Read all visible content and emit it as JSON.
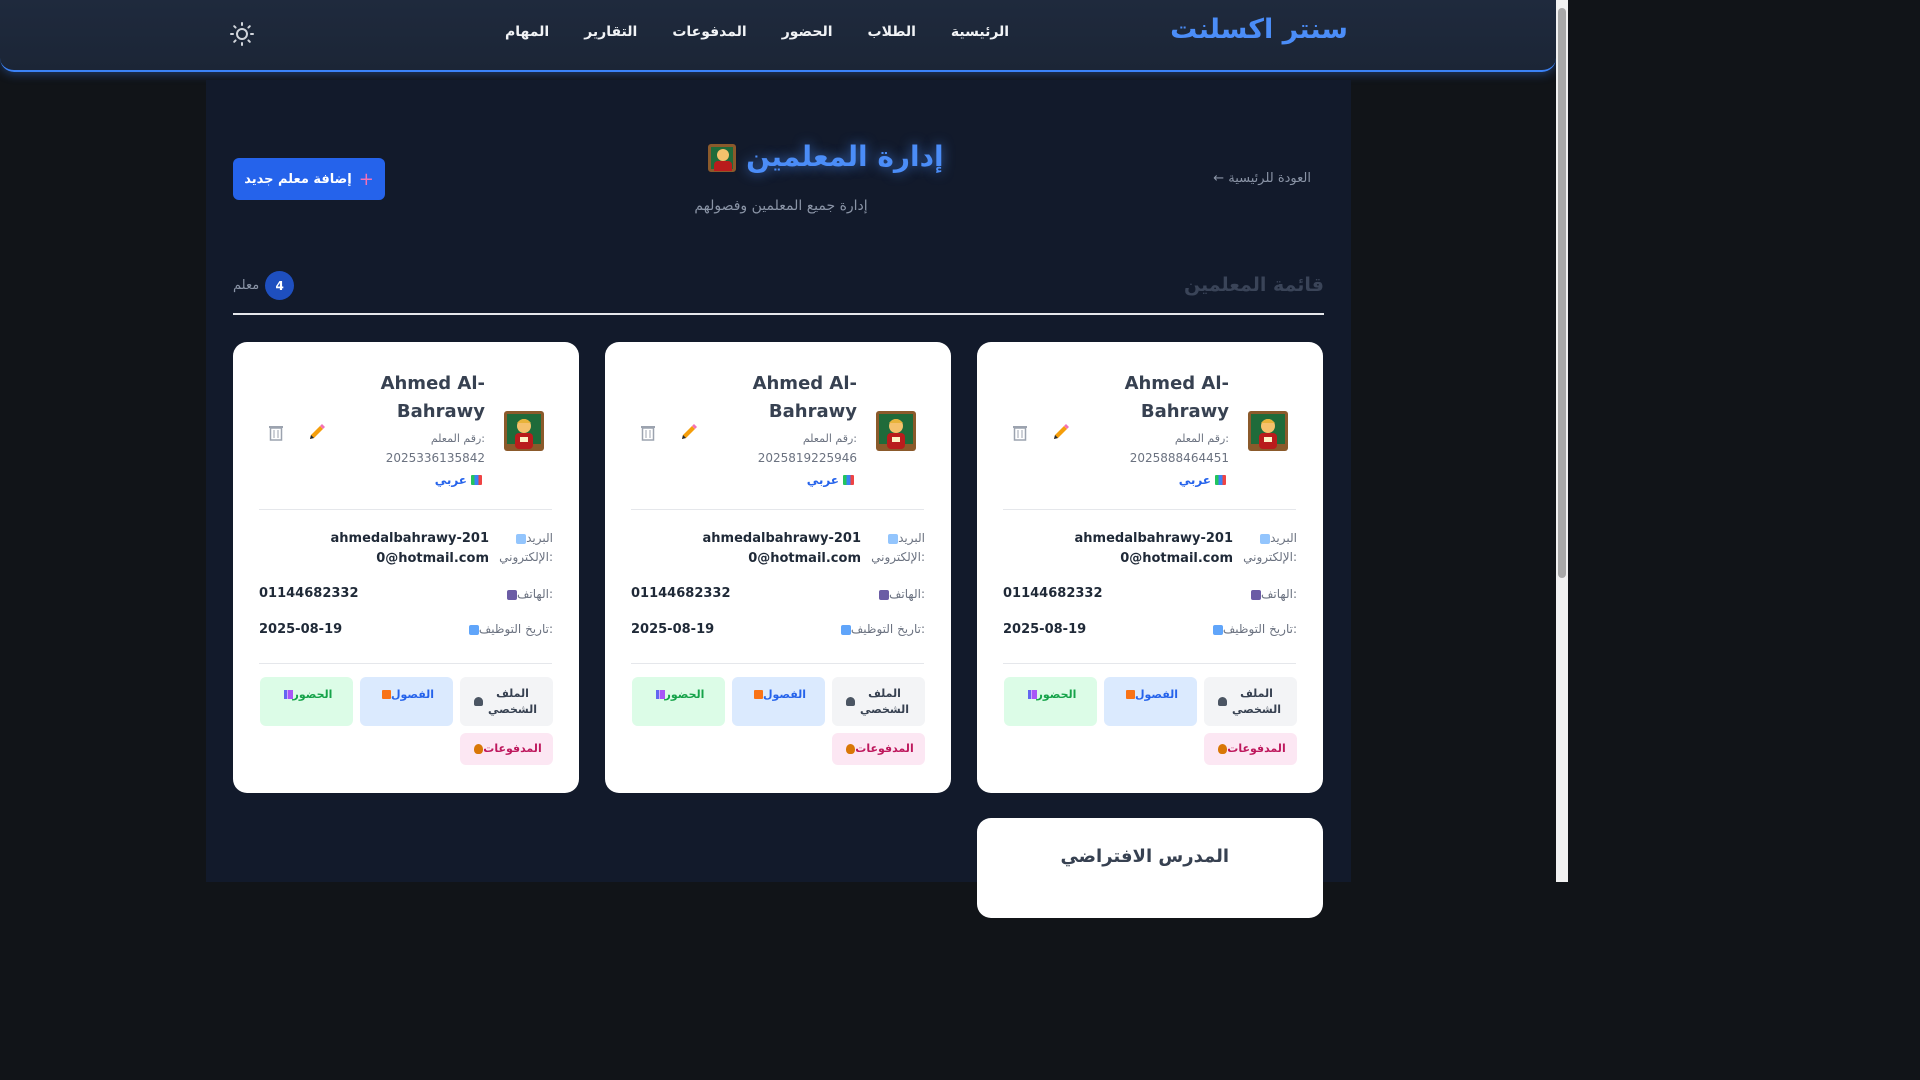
{
  "navbar": {
    "brand": "سنتر اكسلنت",
    "links": [
      "الرئيسية",
      "الطلاب",
      "الحضور",
      "المدفوعات",
      "التقارير",
      "المهام"
    ],
    "theme_icon": "sun-icon"
  },
  "page": {
    "title": "إدارة المعلمين",
    "title_icon": "teacher-icon",
    "subtitle": "إدارة جميع المعلمين وفصولهم",
    "back_link": "← العودة للرئيسية",
    "add_button": "إضافة معلم جديد",
    "add_icon": "plus-icon"
  },
  "list": {
    "title": "قائمة المعلمين",
    "count": "4",
    "count_label": "معلم"
  },
  "labels": {
    "teacher_number": "رقم المعلم:",
    "email": "البريد الإلكتروني:",
    "phone": "الهاتف:",
    "hire_date": "تاريخ التوظيف:"
  },
  "actions": {
    "profile": "الملف الشخصي",
    "classes": "الفصول",
    "attendance": "الحضور",
    "payments": "المدفوعات"
  },
  "teachers": [
    {
      "name": "Ahmed Al-Bahrawy",
      "number": "2025888464451",
      "subject": "عربي",
      "email": "ahmedalbahrawy-2010@hotmail.com",
      "phone": "01144682332",
      "hire_date": "2025-08-19"
    },
    {
      "name": "Ahmed Al-Bahrawy",
      "number": "2025819225946",
      "subject": "عربي",
      "email": "ahmedalbahrawy-2010@hotmail.com",
      "phone": "01144682332",
      "hire_date": "2025-08-19"
    },
    {
      "name": "Ahmed Al-Bahrawy",
      "number": "2025336135842",
      "subject": "عربي",
      "email": "ahmedalbahrawy-2010@hotmail.com",
      "phone": "01144682332",
      "hire_date": "2025-08-19"
    },
    {
      "name": "المدرس الافتراضي"
    }
  ],
  "colors": {
    "accent": "#3b82f6",
    "background": "#111418",
    "panel": "#121a2b",
    "subject": "#2563eb"
  }
}
